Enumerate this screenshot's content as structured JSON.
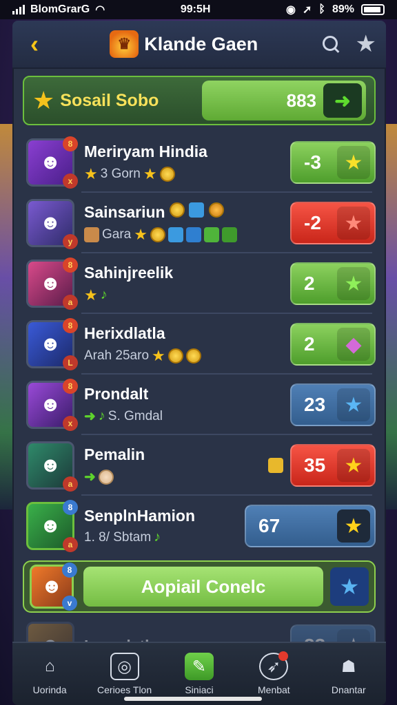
{
  "status": {
    "carrier": "BlomGrarG",
    "time": "99:5H",
    "battery": "89%"
  },
  "header": {
    "title": "Klande Gaen"
  },
  "season": {
    "label": "Sosail Sobo",
    "score": "883"
  },
  "players": [
    {
      "name": "Meriryam Hindia",
      "sub": "3 Gorn",
      "score": "-3",
      "color": "green",
      "score_icon": "star-icon"
    },
    {
      "name": "Sainsariun",
      "sub": "Gara",
      "score": "-2",
      "color": "red",
      "score_icon": "star-icon"
    },
    {
      "name": "Sahinjreelik",
      "sub": "",
      "score": "2",
      "color": "green",
      "score_icon": "star-icon"
    },
    {
      "name": "Herixdlatla",
      "sub": "Arah 25aro",
      "score": "2",
      "color": "green",
      "score_icon": "gem-icon"
    },
    {
      "name": "Prondalt",
      "sub": "S. Gmdal",
      "score": "23",
      "color": "blue",
      "score_icon": "star-icon"
    },
    {
      "name": "Pemalin",
      "sub": "",
      "score": "35",
      "color": "red",
      "score_icon": "star-icon"
    },
    {
      "name": "SenplnHamion",
      "sub": "1. 8/ Sbtam",
      "score": "67",
      "color": "blue",
      "score_icon": "star-icon"
    }
  ],
  "action": {
    "label": "Aopiail Conelc"
  },
  "last_row": {
    "name": "Inoanlatla",
    "score": "23"
  },
  "tabs": [
    {
      "label": "Uorinda",
      "icon": "home-icon"
    },
    {
      "label": "Cerioes Tlon",
      "icon": "camera-icon"
    },
    {
      "label": "Siniaci",
      "icon": "leaf-icon"
    },
    {
      "label": "Menbat",
      "icon": "rocket-icon"
    },
    {
      "label": "Dnantar",
      "icon": "profile-icon"
    }
  ]
}
